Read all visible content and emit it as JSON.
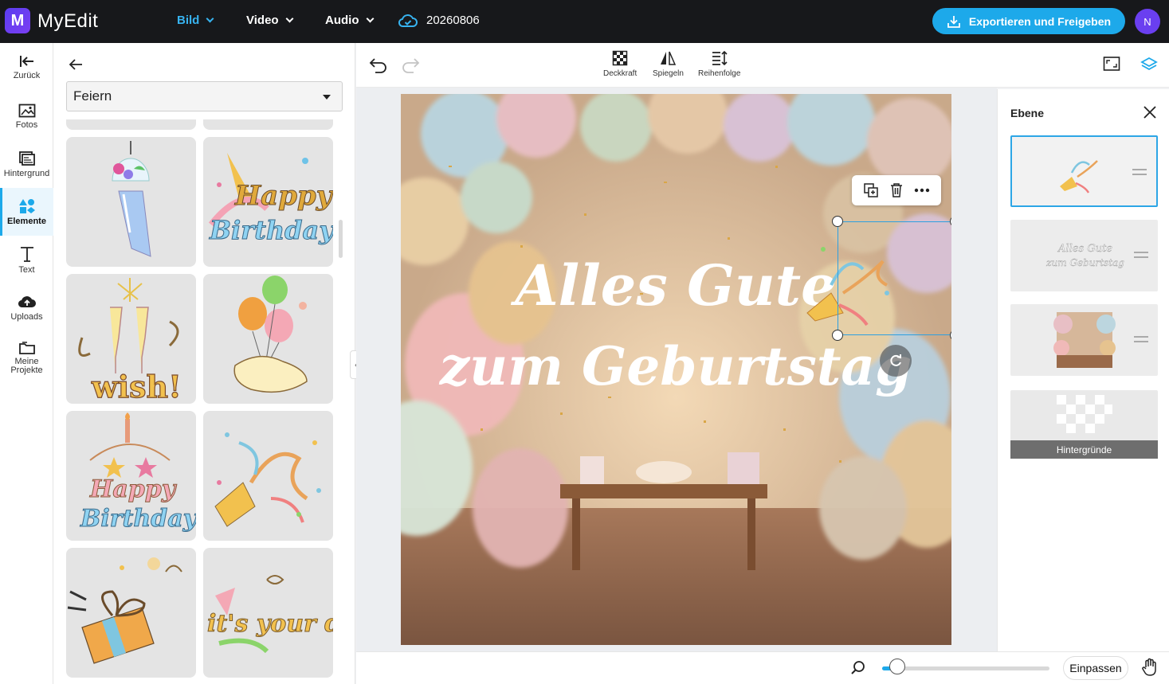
{
  "app": {
    "logo_letter": "M",
    "name": "MyEdit"
  },
  "topnav": [
    {
      "label": "Bild",
      "active": true
    },
    {
      "label": "Video",
      "active": false
    },
    {
      "label": "Audio",
      "active": false
    }
  ],
  "project": {
    "name": "20260806",
    "icon": "cloud-icon"
  },
  "export": {
    "label": "Exportieren und Freigeben",
    "icon": "download-icon"
  },
  "user": {
    "initial": "N"
  },
  "leftnav": [
    {
      "label": "Zurück",
      "icon": "back-arrow-icon"
    },
    {
      "label": "Fotos",
      "icon": "photo-icon"
    },
    {
      "label": "Hintergrund",
      "icon": "background-icon"
    },
    {
      "label": "Elemente",
      "icon": "elements-icon",
      "active": true
    },
    {
      "label": "Text",
      "icon": "text-icon"
    },
    {
      "label": "Uploads",
      "icon": "cloud-upload-icon"
    },
    {
      "label": "Meine Projekte",
      "icon": "folder-icon"
    }
  ],
  "panel": {
    "category": "Feiern"
  },
  "stickers": [
    {
      "name": "wind-chime-sticker"
    },
    {
      "name": "happy-birthday-sticker",
      "text": "Happy Birthday"
    },
    {
      "name": "wish-glasses-sticker",
      "text": "wish!"
    },
    {
      "name": "balloon-dog-sticker"
    },
    {
      "name": "wishing-you-cake-sticker",
      "text": "Happy Birthday"
    },
    {
      "name": "confetti-popper-sticker"
    },
    {
      "name": "gift-box-sticker"
    },
    {
      "name": "its-your-day-sticker",
      "text": "it's your day"
    }
  ],
  "toolbar": {
    "tools": [
      {
        "label": "Deckkraft",
        "icon": "opacity-icon"
      },
      {
        "label": "Spiegeln",
        "icon": "flip-icon"
      },
      {
        "label": "Reihenfolge",
        "icon": "order-icon"
      }
    ]
  },
  "canvas": {
    "line1": "Alles Gute",
    "line2": "zum Geburtstag"
  },
  "layers": {
    "title": "Ebene",
    "items": [
      {
        "name": "confetti-layer",
        "selected": true
      },
      {
        "name": "text-layer",
        "thumb_text_1": "Alles Gute",
        "thumb_text_2": "zum Geburtstag"
      },
      {
        "name": "photo-layer"
      },
      {
        "name": "background-layer",
        "label": "Hintergründe"
      }
    ]
  },
  "bottom": {
    "zoom_fraction": 0.09,
    "fit_label": "Einpassen"
  },
  "colors": {
    "accent": "#1da9ea",
    "brand": "#6a3ff0",
    "topbar": "#17181b"
  }
}
